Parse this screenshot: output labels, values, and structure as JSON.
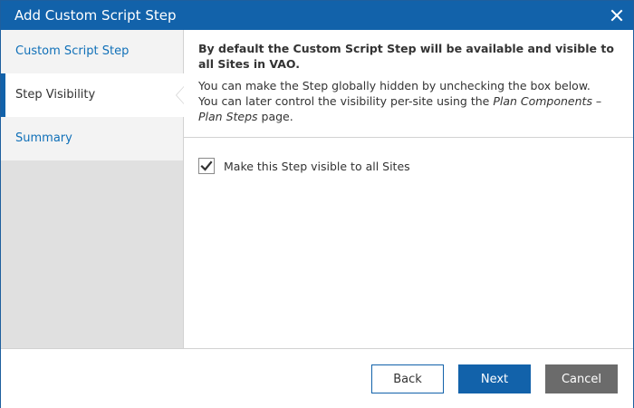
{
  "dialog": {
    "title": "Add Custom Script Step",
    "close_icon": "close-icon"
  },
  "sidebar": {
    "items": [
      {
        "label": "Custom Script Step",
        "active": false
      },
      {
        "label": "Step Visibility",
        "active": true
      },
      {
        "label": "Summary",
        "active": false
      }
    ]
  },
  "content": {
    "intro_bold": "By default the Custom Script Step will be available and visible to all Sites in VAO.",
    "intro_line1": "You can make the Step globally hidden by unchecking the box below.",
    "intro_line2_prefix": "You can later control the visibility per-site using the ",
    "intro_line2_link": "Plan Components – Plan Steps",
    "intro_line2_suffix": " page.",
    "checkbox": {
      "label": "Make this Step visible to all Sites",
      "checked": true
    }
  },
  "footer": {
    "back_label": "Back",
    "next_label": "Next",
    "cancel_label": "Cancel"
  },
  "colors": {
    "titlebar": "#1262aa",
    "sidebar_link": "#1070b8",
    "cancel": "#6b6b6b"
  }
}
